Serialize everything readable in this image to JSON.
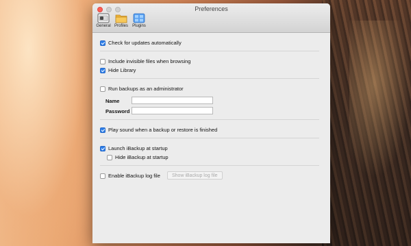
{
  "window": {
    "title": "Preferences"
  },
  "toolbar": {
    "items": [
      {
        "label": "General",
        "icon": "general-switch-icon",
        "selected": true
      },
      {
        "label": "Profiles",
        "icon": "profiles-folder-icon",
        "selected": false
      },
      {
        "label": "Plugins",
        "icon": "plugins-grid-icon",
        "selected": false
      }
    ]
  },
  "options": {
    "check_updates": {
      "label": "Check for updates automatically",
      "checked": true
    },
    "include_invisible": {
      "label": "Include invisible files when browsing",
      "checked": false
    },
    "hide_library": {
      "label": "Hide Library",
      "checked": true
    },
    "run_as_admin": {
      "label": "Run backups as an administrator",
      "checked": false
    },
    "name_label": "Name",
    "name_value": "",
    "password_label": "Password",
    "password_value": "",
    "play_sound": {
      "label": "Play sound when a backup or restore is finished",
      "checked": true
    },
    "launch_startup": {
      "label": "Launch iBackup at startup",
      "checked": true
    },
    "hide_startup": {
      "label": "Hide iBackup at startup",
      "checked": false
    },
    "enable_log": {
      "label": "Enable iBackup log file",
      "checked": false
    },
    "show_log_button": "Show iBackup log file"
  },
  "colors": {
    "accent": "#2f7fe9",
    "close": "#fc5f57"
  }
}
